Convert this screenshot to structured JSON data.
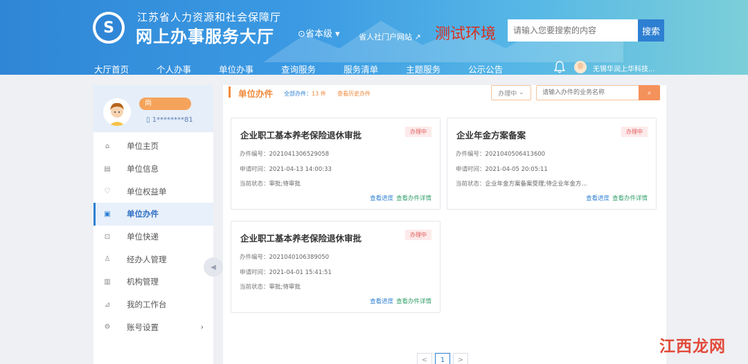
{
  "header": {
    "site_sub": "江苏省人力资源和社会保障厅",
    "site_title": "网上办事服务大厅",
    "region": "省本级",
    "portal_link": "省人社门户网站",
    "test_env": "测试环境",
    "search_placeholder": "请输入您要搜索的内容",
    "search_button": "搜索",
    "user_name": "无锡华润上华科技..."
  },
  "nav": [
    "大厅首页",
    "个人办事",
    "单位办事",
    "查询服务",
    "服务清单",
    "主题服务",
    "公示公告"
  ],
  "profile": {
    "name": "尚",
    "phone": "1********81"
  },
  "sidebar": {
    "items": [
      {
        "label": "单位主页",
        "icon": "home-icon"
      },
      {
        "label": "单位信息",
        "icon": "info-icon"
      },
      {
        "label": "单位权益单",
        "icon": "heart-icon"
      },
      {
        "label": "单位办件",
        "icon": "files-icon"
      },
      {
        "label": "单位快递",
        "icon": "truck-icon"
      },
      {
        "label": "经办人管理",
        "icon": "user-icon"
      },
      {
        "label": "机构管理",
        "icon": "org-icon"
      },
      {
        "label": "我的工作台",
        "icon": "chart-icon"
      },
      {
        "label": "账号设置",
        "icon": "gear-icon"
      }
    ],
    "active_index": 3
  },
  "main": {
    "section_title": "单位办件",
    "count_prefix": "全部办件：",
    "count_value": "13 件",
    "history_link": "查看历史办件",
    "status_filter": "办理中",
    "search_placeholder": "请输入办件的业务名称",
    "cards": [
      {
        "title": "企业职工基本养老保险退休审批",
        "badge": "办理中",
        "no_label": "办件编号：",
        "no_value": "2021041306529058",
        "time_label": "申请时间：",
        "time_value": "2021-04-13 14:00:33",
        "state_label": "当前状态：",
        "state_value": "审批;待审批",
        "link_progress": "查看进度",
        "link_detail": "查看办件详情"
      },
      {
        "title": "企业年金方案备案",
        "badge": "办理中",
        "no_label": "办件编号：",
        "no_value": "2021040506413600",
        "time_label": "申请时间：",
        "time_value": "2021-04-05 20:05:11",
        "state_label": "当前状态：",
        "state_value": "企业年金方案备案受理;待企业年金方...",
        "link_progress": "查看进度",
        "link_detail": "查看办件详情"
      },
      {
        "title": "企业职工基本养老保险退休审批",
        "badge": "办理中",
        "no_label": "办件编号：",
        "no_value": "2021040106389050",
        "time_label": "申请时间：",
        "time_value": "2021-04-01 15:41:51",
        "state_label": "当前状态：",
        "state_value": "审批;待审批",
        "link_progress": "查看进度",
        "link_detail": "查看办件详情"
      }
    ],
    "pager": {
      "prev": "<",
      "current": "1",
      "next": ">"
    }
  },
  "watermark": "江西龙网",
  "colors": {
    "brand": "#2f86d6",
    "accent": "#f08a3c",
    "badge": "#e05b5b",
    "link": "#2d7fd2",
    "link_green": "#33a06a"
  }
}
